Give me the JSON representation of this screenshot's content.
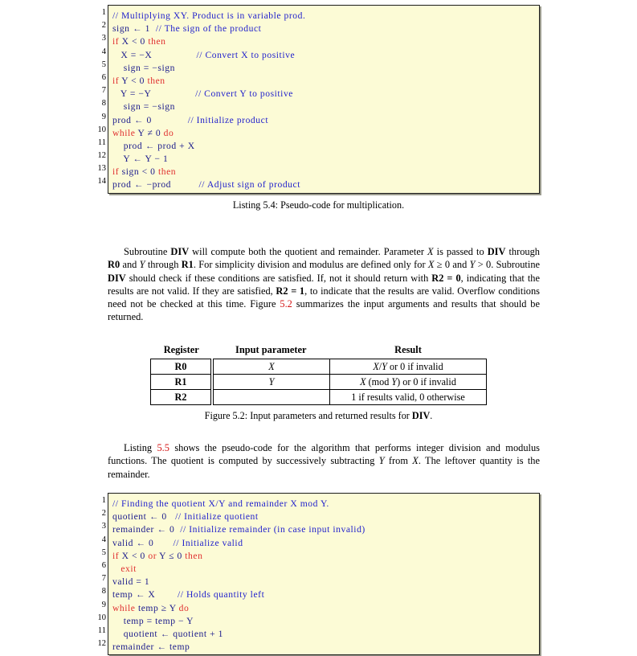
{
  "listing1": {
    "name": "pseudo-code-multiplication",
    "caption": "Listing 5.4: Pseudo-code for multiplication.",
    "lines": [
      {
        "n": "1",
        "segments": [
          {
            "t": "// Multiplying XY. Product is in variable prod.",
            "c": "cmt"
          }
        ]
      },
      {
        "n": "2",
        "segments": [
          {
            "t": "sign ← 1  ",
            "c": "var"
          },
          {
            "t": "// The sign of the product",
            "c": "cmt"
          }
        ]
      },
      {
        "n": "3",
        "segments": [
          {
            "t": "if ",
            "c": "kw"
          },
          {
            "t": "X < 0 ",
            "c": "var"
          },
          {
            "t": "then",
            "c": "kw"
          }
        ]
      },
      {
        "n": "4",
        "segments": [
          {
            "t": "   X = −X",
            "c": "var"
          },
          {
            "t": "                ",
            "c": "var"
          },
          {
            "t": "// Convert X to positive",
            "c": "cmt"
          }
        ]
      },
      {
        "n": "5",
        "segments": [
          {
            "t": "    sign = −sign",
            "c": "var"
          }
        ]
      },
      {
        "n": "6",
        "segments": [
          {
            "t": "if ",
            "c": "kw"
          },
          {
            "t": "Y < 0 ",
            "c": "var"
          },
          {
            "t": "then",
            "c": "kw"
          }
        ]
      },
      {
        "n": "7",
        "segments": [
          {
            "t": "   Y = −Y",
            "c": "var"
          },
          {
            "t": "                ",
            "c": "var"
          },
          {
            "t": "// Convert Y to positive",
            "c": "cmt"
          }
        ]
      },
      {
        "n": "8",
        "segments": [
          {
            "t": "    sign = −sign",
            "c": "var"
          }
        ]
      },
      {
        "n": "9",
        "segments": [
          {
            "t": "prod ← 0",
            "c": "var"
          },
          {
            "t": "             ",
            "c": "var"
          },
          {
            "t": "// Initialize product",
            "c": "cmt"
          }
        ]
      },
      {
        "n": "10",
        "segments": [
          {
            "t": "while ",
            "c": "kw"
          },
          {
            "t": "Y ≠ 0 ",
            "c": "var"
          },
          {
            "t": "do",
            "c": "kw"
          }
        ]
      },
      {
        "n": "11",
        "segments": [
          {
            "t": "    prod ← prod + X",
            "c": "var"
          }
        ]
      },
      {
        "n": "12",
        "segments": [
          {
            "t": "    Y ← Y − 1",
            "c": "var"
          }
        ]
      },
      {
        "n": "13",
        "segments": [
          {
            "t": "if ",
            "c": "kw"
          },
          {
            "t": "sign < 0 ",
            "c": "var"
          },
          {
            "t": "then",
            "c": "kw"
          }
        ]
      },
      {
        "n": "14",
        "segments": [
          {
            "t": "prod ← −prod",
            "c": "var"
          },
          {
            "t": "          ",
            "c": "var"
          },
          {
            "t": "// Adjust sign of product",
            "c": "cmt"
          }
        ]
      }
    ]
  },
  "paragraph1": {
    "html": "<span class=\"ind\"></span>Subroutine <b>DIV</b> will compute both the quotient and remainder. Parameter <i class=\"mathvar\">X</i> is passed to <b>DIV</b> through <b>R0</b> and <i class=\"mathvar\">Y</i> through <b>R1</b>. For simplicity division and modulus are defined only for <i class=\"mathvar\">X</i> ≥ 0 and <i class=\"mathvar\">Y</i> &gt; 0. Subroutine <b>DIV</b> should check if these conditions are satisfied. If, not it should return with <b>R2 = 0</b>, indicating that the results are not valid. If they are satisfied, <b>R2 = 1</b>, to indicate that the results are valid. Overflow conditions need not be checked at this time. Figure <span class=\"ref\">5.2</span> summarizes the input arguments and results that should be returned."
  },
  "figure_table": {
    "name": "div-parameters-table",
    "headers": [
      "Register",
      "Input parameter",
      "Result"
    ],
    "rows": [
      {
        "register": "R0",
        "input": "X",
        "result": "X/Y or 0 if invalid"
      },
      {
        "register": "R1",
        "input": "Y",
        "result": "X (mod Y) or 0 if invalid"
      },
      {
        "register": "R2",
        "input": "",
        "result": "1 if results valid, 0 otherwise"
      }
    ],
    "caption": "Figure 5.2: Input parameters and returned results for DIV."
  },
  "paragraph2": {
    "html": "<span class=\"ind\"></span>Listing <span class=\"ref\">5.5</span> shows the pseudo-code for the algorithm that performs integer division and modulus functions. The quotient is computed by successively subtracting <i class=\"mathvar\">Y</i> from <i class=\"mathvar\">X</i>. The leftover quantity is the remainder."
  },
  "listing2": {
    "name": "pseudo-code-division",
    "lines": [
      {
        "n": "1",
        "segments": [
          {
            "t": "// Finding the quotient X/Y and remainder X mod Y.",
            "c": "cmt"
          }
        ]
      },
      {
        "n": "2",
        "segments": [
          {
            "t": "quotient ← 0   ",
            "c": "var"
          },
          {
            "t": "// Initialize quotient",
            "c": "cmt"
          }
        ]
      },
      {
        "n": "3",
        "segments": [
          {
            "t": "remainder ← 0  ",
            "c": "var"
          },
          {
            "t": "// Initialize remainder (in case input invalid)",
            "c": "cmt"
          }
        ]
      },
      {
        "n": "4",
        "segments": [
          {
            "t": "valid ← 0",
            "c": "var"
          },
          {
            "t": "       ",
            "c": "var"
          },
          {
            "t": "// Initialize valid",
            "c": "cmt"
          }
        ]
      },
      {
        "n": "5",
        "segments": [
          {
            "t": "if ",
            "c": "kw"
          },
          {
            "t": "X < 0 ",
            "c": "var"
          },
          {
            "t": "or ",
            "c": "kw"
          },
          {
            "t": "Y ≤ 0 ",
            "c": "var"
          },
          {
            "t": "then",
            "c": "kw"
          }
        ]
      },
      {
        "n": "6",
        "segments": [
          {
            "t": "   exit",
            "c": "kw"
          }
        ]
      },
      {
        "n": "7",
        "segments": [
          {
            "t": "valid = 1",
            "c": "var"
          }
        ]
      },
      {
        "n": "8",
        "segments": [
          {
            "t": "temp ← X",
            "c": "var"
          },
          {
            "t": "        ",
            "c": "var"
          },
          {
            "t": "// Holds quantity left",
            "c": "cmt"
          }
        ]
      },
      {
        "n": "9",
        "segments": [
          {
            "t": "while ",
            "c": "kw"
          },
          {
            "t": "temp ≥ Y ",
            "c": "var"
          },
          {
            "t": "do",
            "c": "kw"
          }
        ]
      },
      {
        "n": "10",
        "segments": [
          {
            "t": "    temp = temp − Y",
            "c": "var"
          }
        ]
      },
      {
        "n": "11",
        "segments": [
          {
            "t": "    quotient ← quotient + 1",
            "c": "var"
          }
        ]
      },
      {
        "n": "12",
        "segments": [
          {
            "t": "remainder ← temp",
            "c": "var"
          }
        ]
      }
    ]
  },
  "colors": {
    "code_background": "#fcfbd6",
    "code_border": "#1b1b1b",
    "keyword": "#e03030",
    "comment": "#2222cc",
    "variable": "#1a1a8c",
    "reference_link": "#d41414",
    "page_background": "#ffffff"
  }
}
